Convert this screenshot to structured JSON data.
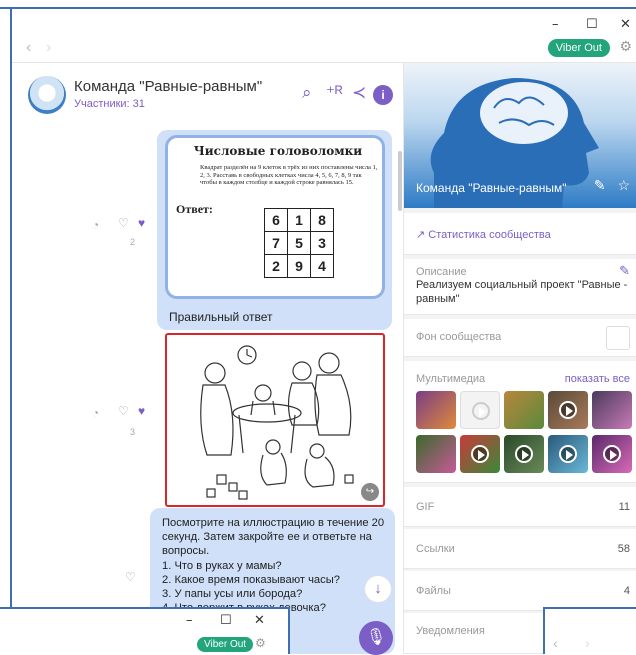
{
  "window": {
    "minimize": "–",
    "maximize": "☐",
    "close": "✕"
  },
  "nav": {
    "back": "‹",
    "forward": "›",
    "viber_out": "Viber Out"
  },
  "chat": {
    "title": "Команда \"Равные-равным\"",
    "members": "Участники: 31",
    "puzzle": {
      "title": "Числовые головоломки",
      "text": "Квадрат разделён на 9 клеток в трёх из них поставлены числа 1, 2, 3. Расставь в свободных клетках числа 4, 5, 6, 7, 8, 9 так чтобы в каждом столбце и каждой строке равнялась 15.",
      "answer": "Ответ:",
      "grid": [
        [
          "6",
          "1",
          "8"
        ],
        [
          "7",
          "5",
          "3"
        ],
        [
          "2",
          "9",
          "4"
        ]
      ]
    },
    "puzzle_caption": "Правильный ответ",
    "like_count_1": "2",
    "like_count_2": "3",
    "message_lines": [
      "Посмотрите на иллюстрацию в течение 20",
      "секунд. Затем закройте ее и ответьте на",
      "вопросы.",
      "1. Что в руках у мамы?",
      "2. Какое время показывают часы?",
      "3. У папы усы или борода?",
      "4. Что держит в руках девочка?"
    ]
  },
  "community": {
    "name": "Команда \"Равные-равным\"",
    "stats": "Статистика сообщества",
    "description_label": "Описание",
    "description": "Реализуем социальный проект \"Равные - равным\"",
    "background_label": "Фон сообщества",
    "media_label": "Мультимедиа",
    "show_all": "показать все",
    "gif_label": "GIF",
    "gif_count": "11",
    "links_label": "Ссылки",
    "links_count": "58",
    "files_label": "Файлы",
    "files_count": "4",
    "notifications_label": "Уведомления"
  },
  "colors": {
    "accent": "#7b5ec6",
    "viber_out": "#22a57a",
    "frame": "#3f6fb3",
    "bubble": "#cfe0f8"
  },
  "bottom_window": {
    "viber_out": "Viber Out",
    "minimize": "–",
    "maximize": "☐",
    "close": "✕"
  }
}
